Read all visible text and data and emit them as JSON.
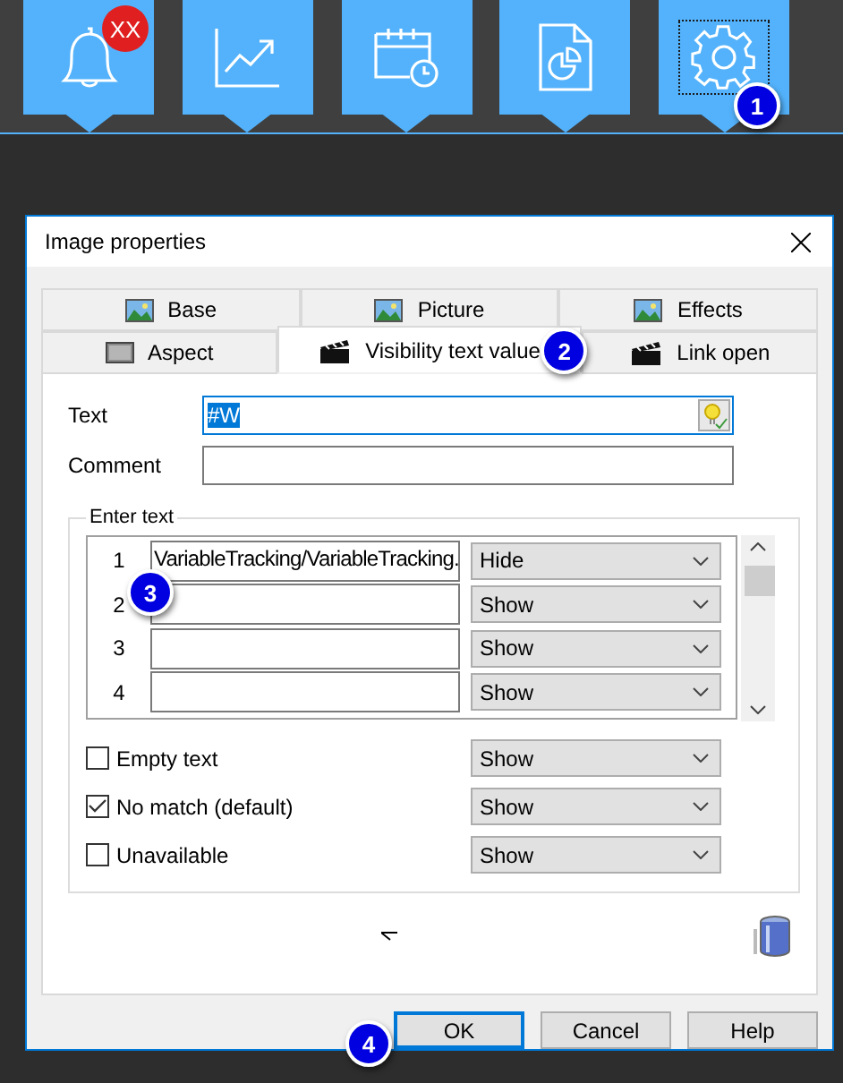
{
  "toolbar": {
    "tiles": [
      {
        "kind": "bell",
        "badge": "XX",
        "selected": false
      },
      {
        "kind": "chart",
        "selected": false
      },
      {
        "kind": "calendar",
        "selected": false
      },
      {
        "kind": "report",
        "selected": false
      },
      {
        "kind": "gear",
        "selected": true,
        "callout": "1"
      }
    ]
  },
  "dialog": {
    "title": "Image properties",
    "tab_rows": [
      [
        {
          "label": "Base",
          "kind": "picture",
          "selected": false
        },
        {
          "label": "Picture",
          "kind": "picture",
          "selected": false
        },
        {
          "label": "Effects",
          "kind": "picture",
          "selected": false
        }
      ],
      [
        {
          "label": "Aspect",
          "kind": "aspect",
          "selected": false
        },
        {
          "label": "Visibility text value",
          "kind": "clapper",
          "selected": true,
          "callout": "2"
        },
        {
          "label": "Link open",
          "kind": "clapper",
          "selected": false
        }
      ]
    ],
    "fields": [
      {
        "label": "Text",
        "value": "#W",
        "selected": true,
        "kind": "bulb"
      },
      {
        "label": "Comment",
        "selected": false,
        "kind": "plain"
      }
    ],
    "group": {
      "legend": "Enter text",
      "rows": [
        {
          "number": "1",
          "value": "VariableTracking/VariableTracking.",
          "option": "Hide",
          "callout": "3"
        },
        {
          "number": "2",
          "option": "Show"
        },
        {
          "number": "3",
          "option": "Show"
        },
        {
          "number": "4",
          "option": "Show"
        }
      ],
      "checks": [
        {
          "label": "Empty text",
          "checked": false,
          "option": "Show"
        },
        {
          "label": "No match (default)",
          "checked": true,
          "option": "Show"
        },
        {
          "label": "Unavailable",
          "checked": false,
          "option": "Show"
        }
      ]
    },
    "buttons": [
      {
        "label": "OK",
        "default": true,
        "callout": "4"
      },
      {
        "label": "Cancel",
        "default": false
      },
      {
        "label": "Help",
        "default": false
      }
    ]
  }
}
